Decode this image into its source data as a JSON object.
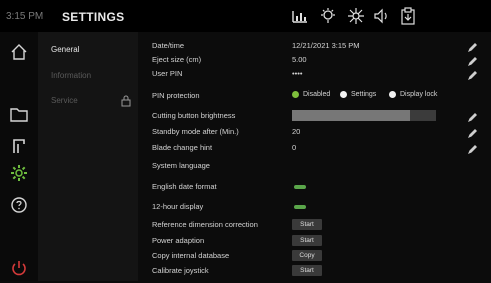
{
  "header": {
    "time": "3:15 PM",
    "title": "SETTINGS",
    "icons": [
      "stats-icon",
      "light-icon",
      "brightness-icon",
      "sound-icon",
      "clipboard-icon"
    ]
  },
  "nav_rail": {
    "icons": [
      "home-icon",
      "folder-icon",
      "blade-icon",
      "settings-gear-icon",
      "help-icon",
      "power-icon"
    ],
    "active": "settings-gear-icon",
    "accent_colors": {
      "active": "#6fbf3f",
      "power": "#d43a3a"
    }
  },
  "menu": {
    "items": [
      {
        "label": "General",
        "state": "active"
      },
      {
        "label": "Information",
        "state": "dim"
      },
      {
        "label": "Service",
        "state": "dim",
        "locked": true
      }
    ]
  },
  "settings": {
    "date_time": {
      "label": "Date/time",
      "value": "12/21/2021 3:15 PM"
    },
    "eject_size": {
      "label": "Eject size (cm)",
      "value": "5.00"
    },
    "user_pin": {
      "label": "User PIN",
      "value": "••••"
    },
    "pin_protection": {
      "label": "PIN protection",
      "options": [
        "Disabled",
        "Settings",
        "Display lock"
      ],
      "selected": "Disabled"
    },
    "cutting_brightness": {
      "label": "Cutting button brightness",
      "level": 0.82
    },
    "standby": {
      "label": "Standby mode after (Min.)",
      "value": "20"
    },
    "blade_hint": {
      "label": "Blade change hint",
      "value": "0"
    },
    "system_language": {
      "label": "System language",
      "value": ""
    },
    "english_date": {
      "label": "English date format",
      "enabled": true
    },
    "hour12": {
      "label": "12-hour display",
      "enabled": true
    },
    "ref_dim": {
      "label": "Reference dimension correction",
      "button": "Start"
    },
    "power_adaption": {
      "label": "Power adaption",
      "button": "Start"
    },
    "copy_db": {
      "label": "Copy internal database",
      "button": "Copy"
    },
    "calibrate": {
      "label": "Calibrate joystick",
      "button": "Start"
    }
  },
  "colors": {
    "toggle_on": "#5aa64a",
    "radio_selected": "#7fbf3c"
  }
}
